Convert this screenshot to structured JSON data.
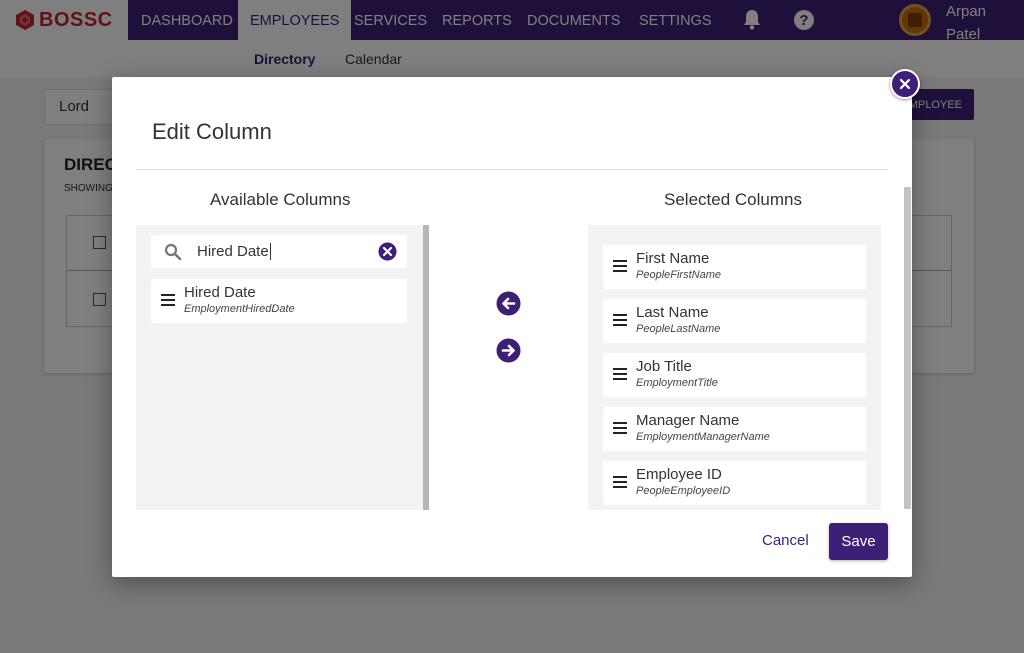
{
  "brand": {
    "name": "BOSSC"
  },
  "nav": {
    "items": [
      {
        "label": "DASHBOARD"
      },
      {
        "label": "EMPLOYEES"
      },
      {
        "label": "SERVICES"
      },
      {
        "label": "REPORTS"
      },
      {
        "label": "DOCUMENTS"
      },
      {
        "label": "SETTINGS"
      }
    ],
    "active": "EMPLOYEES",
    "user_name": "Arpan Patel"
  },
  "subnav": {
    "items": [
      {
        "label": "Directory"
      },
      {
        "label": "Calendar"
      }
    ],
    "active": "Directory"
  },
  "background_page": {
    "search_value": "Lord",
    "add_button_label": "MPLOYEE",
    "card_title": "DIREC",
    "card_subtitle": "SHOWING"
  },
  "modal": {
    "title": "Edit Column",
    "available_heading": "Available Columns",
    "selected_heading": "Selected Columns",
    "search_value": "Hired Date",
    "available_columns": [
      {
        "name": "Hired Date",
        "key": "EmploymentHiredDate"
      }
    ],
    "selected_columns": [
      {
        "name": "First Name",
        "key": "PeopleFirstName"
      },
      {
        "name": "Last Name",
        "key": "PeopleLastName"
      },
      {
        "name": "Job Title",
        "key": "EmploymentTitle"
      },
      {
        "name": "Manager Name",
        "key": "EmploymentManagerName"
      },
      {
        "name": "Employee ID",
        "key": "PeopleEmployeeID"
      }
    ],
    "cancel_label": "Cancel",
    "save_label": "Save"
  },
  "colors": {
    "primary": "#3e1f77",
    "brand_red": "#c8232c"
  }
}
